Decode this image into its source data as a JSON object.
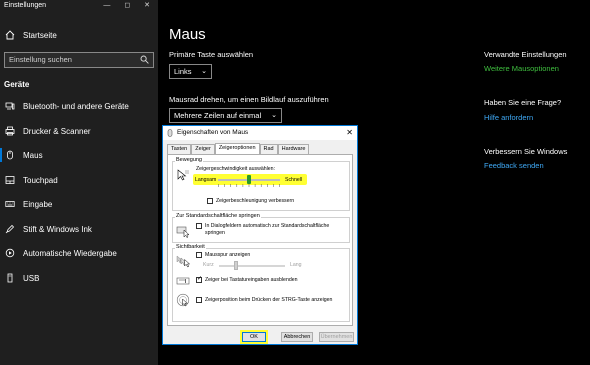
{
  "app": {
    "title": "Einstellungen",
    "window_controls": "— ◻ ✕"
  },
  "sidebar": {
    "home": "Startseite",
    "search_placeholder": "Einstellung suchen",
    "group": "Geräte",
    "items": [
      {
        "label": "Bluetooth- und andere Geräte",
        "icon": "bluetooth-icon"
      },
      {
        "label": "Drucker & Scanner",
        "icon": "printer-icon"
      },
      {
        "label": "Maus",
        "icon": "mouse-icon"
      },
      {
        "label": "Touchpad",
        "icon": "touchpad-icon"
      },
      {
        "label": "Eingabe",
        "icon": "keyboard-icon"
      },
      {
        "label": "Stift & Windows Ink",
        "icon": "pen-icon"
      },
      {
        "label": "Automatische Wiedergabe",
        "icon": "autoplay-icon"
      },
      {
        "label": "USB",
        "icon": "usb-icon"
      }
    ]
  },
  "main": {
    "title": "Maus",
    "primary_label": "Primäre Taste auswählen",
    "primary_value": "Links",
    "wheel_label": "Mausrad drehen, um einen Bildlauf auszuführen",
    "wheel_value": "Mehrere Zeilen auf einmal"
  },
  "right": {
    "related_heading": "Verwandte Einstellungen",
    "related_link": "Weitere Mausoptionen",
    "question_heading": "Haben Sie eine Frage?",
    "question_link": "Hilfe anfordern",
    "improve_heading": "Verbessern Sie Windows",
    "improve_link": "Feedback senden"
  },
  "dialog": {
    "title": "Eigenschaften von Maus",
    "tabs": [
      "Tasten",
      "Zeiger",
      "Zeigeroptionen",
      "Rad",
      "Hardware"
    ],
    "selected_tab": "Zeigeroptionen",
    "motion": {
      "group": "Bewegung",
      "speed_label": "Zeigergeschwindigkeit auswählen:",
      "slow": "Langsam",
      "fast": "Schnell",
      "speed_level": 0.5,
      "precision_label": "Zeigerbeschleunigung verbessern",
      "precision_checked": false
    },
    "snap": {
      "group": "Zur Standardschaltfläche springen",
      "label_line1": "In Dialogfeldern automatisch zur Standardschaltfläche",
      "label_line2": "springen",
      "checked": false
    },
    "visibility": {
      "group": "Sichtbarkeit",
      "trails_label": "Mausspur anzeigen",
      "trails_checked": false,
      "short": "Kurz",
      "long": "Lang",
      "hide_label": "Zeiger bei Tastatureingaben ausblenden",
      "hide_checked": true,
      "ctrl_label": "Zeigerposition beim Drücken der STRG-Taste anzeigen",
      "ctrl_checked": false
    },
    "buttons": {
      "ok": "OK",
      "cancel": "Abbrechen",
      "apply": "Übernehmen"
    }
  },
  "colors": {
    "accent": "#0078d7",
    "link": "#3fa9f5",
    "highlight": "#ffff33",
    "green_link": "#3fbf3f"
  }
}
